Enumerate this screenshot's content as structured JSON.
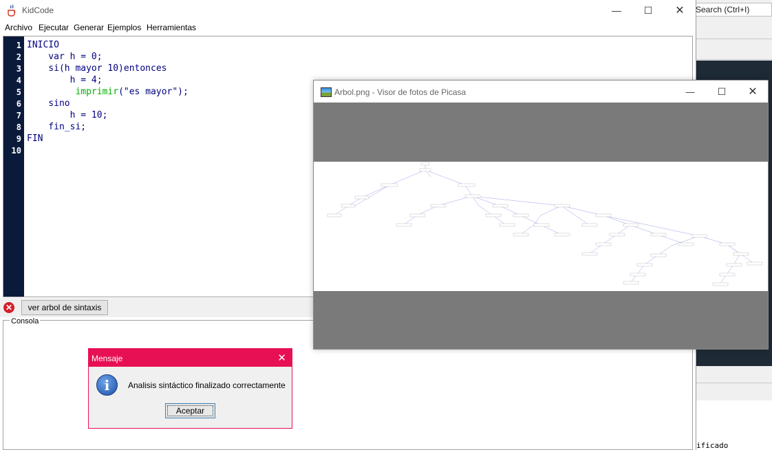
{
  "background": {
    "search_placeholder": "Search (Ctrl+I)",
    "code_fragment": "ificado"
  },
  "kidcode": {
    "title": "KidCode",
    "menu": [
      "Archivo",
      "Ejecutar",
      "Generar",
      "Ejemplos",
      "Herramientas"
    ],
    "line_numbers": [
      "1",
      "2",
      "3",
      "4",
      "5",
      "6",
      "7",
      "8",
      "9",
      "10"
    ],
    "code": {
      "l1": "INICIO",
      "l2": "    var h = 0;",
      "l3a": "    si(h mayor 10)entonces",
      "l4": "        h = 4;",
      "l5a": "         ",
      "l5b": "imprimir",
      "l5c": "(\"es mayor\");",
      "l6": "    sino",
      "l7": "        h = 10;",
      "l8": "    fin_si;",
      "l9": "FIN"
    },
    "ver_arbol_label": "ver arbol de sintaxis",
    "consola_label": "Consola"
  },
  "picasa": {
    "title": "Arbol.png - Visor de fotos de Picasa"
  },
  "dialog": {
    "title": "Mensaje",
    "message": "Analisis sintáctico finalizado correctamente",
    "ok_label": "Aceptar"
  },
  "colors": {
    "dialog_accent": "#e81055",
    "gutter": "#0a1a3a",
    "keyword_blue": "#000080",
    "function_green": "#00b000"
  }
}
